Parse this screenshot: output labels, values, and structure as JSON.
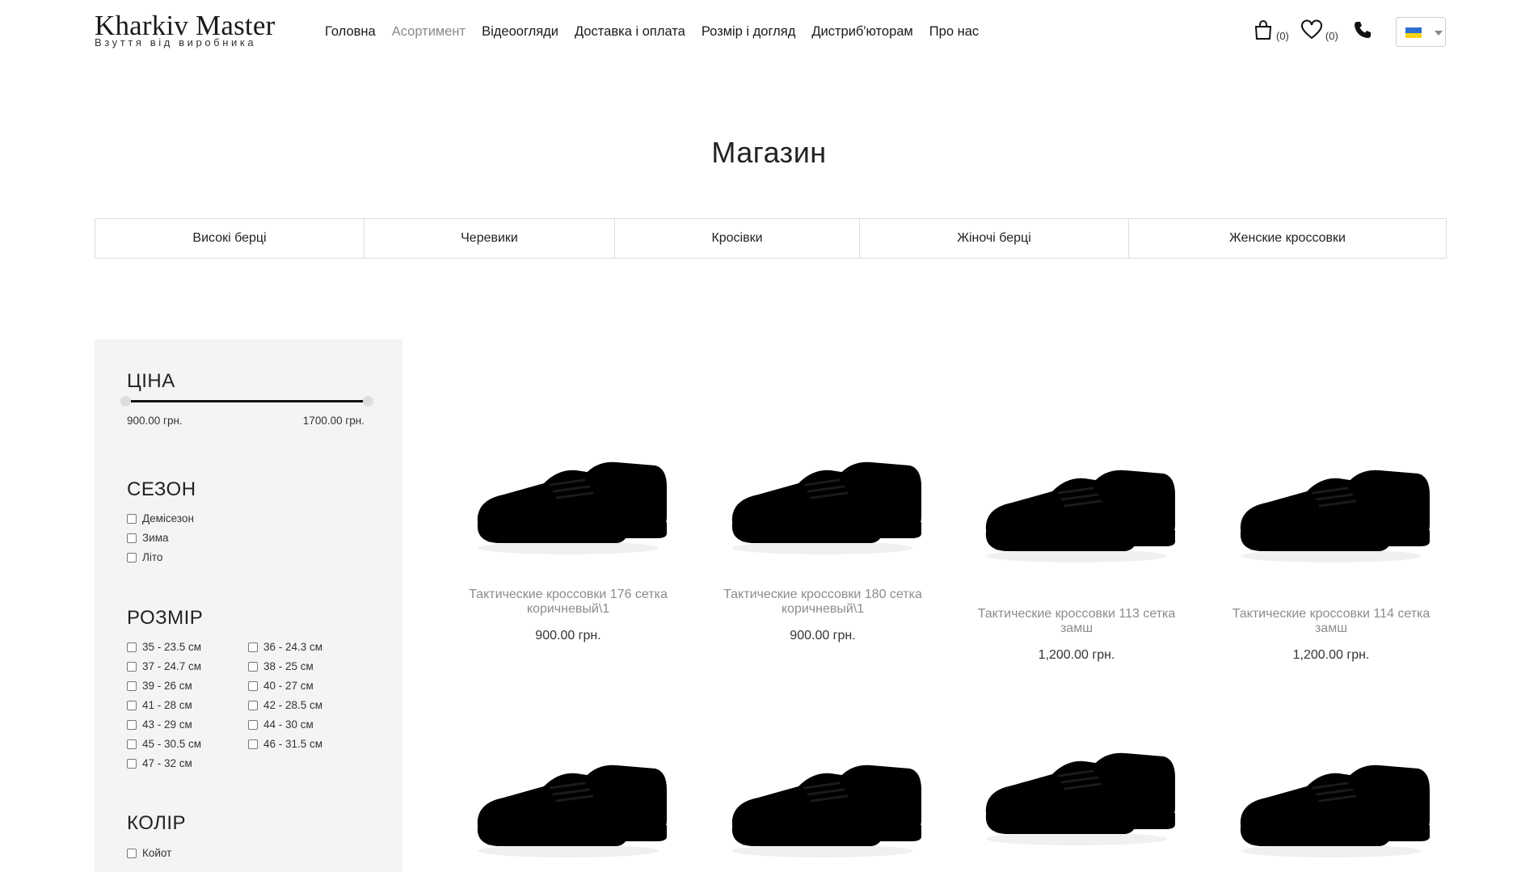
{
  "header": {
    "logo_title": "Kharkiv Master",
    "logo_subtitle": "Взуття від виробника",
    "nav": [
      "Головна",
      "Асортимент",
      "Відеоогляди",
      "Доставка і оплата",
      "Розмір і догляд",
      "Дистриб'юторам",
      "Про нас"
    ],
    "active_nav": "Асортимент",
    "cart_count": "(0)",
    "wishlist_count": "(0)",
    "language_flag": "ukraine-flag"
  },
  "page_title": "Магазин",
  "categories": [
    "Високі берці",
    "Черевики",
    "Кросівки",
    "Жіночі берці",
    "Женские кроссовки"
  ],
  "filters": {
    "price": {
      "title": "ЦІНА",
      "min": "900.00 грн.",
      "max": "1700.00 грн."
    },
    "season": {
      "title": "СЕЗОН",
      "options": [
        "Демісезон",
        "Зима",
        "Літо"
      ]
    },
    "size": {
      "title": "РОЗМІР",
      "options": [
        "35 - 23.5 см",
        "36 - 24.3 см",
        "37 - 24.7 см",
        "38 - 25 см",
        "39 - 26 см",
        "40 - 27 см",
        "41 - 28 см",
        "42 - 28.5 см",
        "43 - 29 см",
        "44 - 30 см",
        "45 - 30.5 см",
        "46 - 31.5 см",
        "47 - 32 см"
      ]
    },
    "color": {
      "title": "КОЛІР",
      "options": [
        "Койот"
      ]
    }
  },
  "products": [
    {
      "name_line1": "Тактические кроссовки 176 сетка",
      "name_line2": "коричневый\\1",
      "price": "900.00 грн.",
      "image": "olive-brown-sneaker"
    },
    {
      "name_line1": "Тактические кроссовки 180 сетка",
      "name_line2": "коричневый\\1",
      "price": "900.00 грн.",
      "image": "brown-black-sneaker"
    },
    {
      "name_line1": "Тактические кроссовки 113 сетка",
      "name_line2": "замш",
      "price": "1,200.00 грн.",
      "image": "coyote-suede-sneaker"
    },
    {
      "name_line1": "Тактические кроссовки 114 сетка",
      "name_line2": "замш",
      "price": "1,200.00 грн.",
      "image": "coyote-suede-sneaker"
    },
    {
      "image": "coyote-sneaker"
    },
    {
      "image": "coyote-sneaker"
    },
    {
      "image": "black-sneaker"
    },
    {
      "image": "olive-sneaker"
    }
  ],
  "colors": {
    "coyote": "#a9825a",
    "olive": "#6f6a52",
    "black": "#222222",
    "sidebar_bg": "#f4f4f4"
  }
}
